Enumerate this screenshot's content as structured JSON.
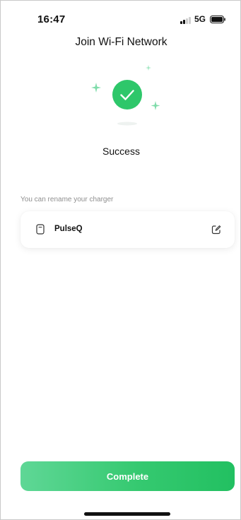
{
  "status_bar": {
    "time": "16:47",
    "network": "5G",
    "icons": [
      "signal-icon",
      "battery-icon"
    ]
  },
  "header": {
    "title": "Join Wi-Fi Network"
  },
  "result": {
    "icon": "check-circle-icon",
    "status": "Success"
  },
  "rename": {
    "hint": "You can rename your charger",
    "charger_name": "PulseQ",
    "icons": [
      "charger-icon",
      "edit-icon"
    ]
  },
  "actions": {
    "complete_label": "Complete"
  },
  "colors": {
    "accent": "#2ec76a",
    "accent_light": "#6bdc9d",
    "hint_text": "#8f8f8f"
  }
}
